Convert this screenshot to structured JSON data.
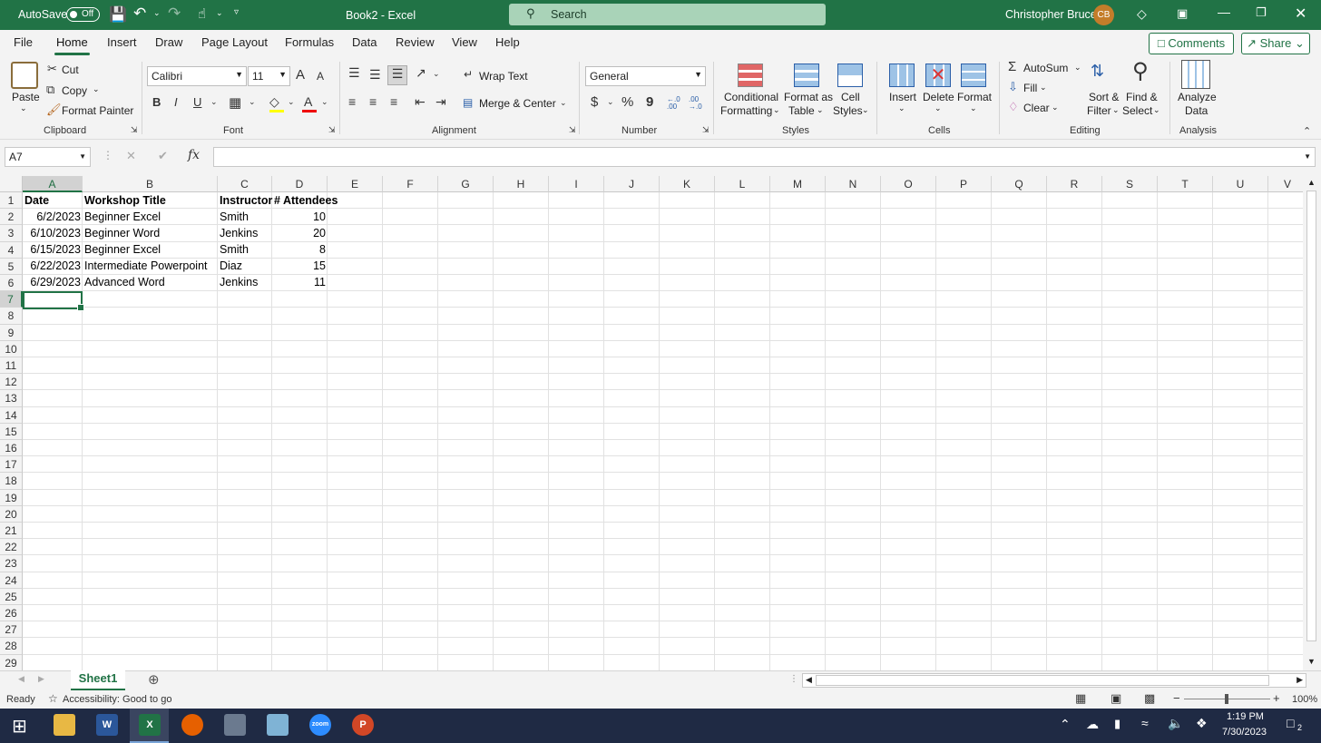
{
  "titlebar": {
    "autosave_label": "AutoSave",
    "autosave_state": "Off",
    "doc_title": "Book2  -  Excel",
    "search_placeholder": "Search",
    "user_name": "Christopher Bruce",
    "user_initials": "CB"
  },
  "tabs": [
    "File",
    "Home",
    "Insert",
    "Draw",
    "Page Layout",
    "Formulas",
    "Data",
    "Review",
    "View",
    "Help"
  ],
  "active_tab": "Home",
  "tab_buttons": {
    "comments": "Comments",
    "share": "Share"
  },
  "ribbon": {
    "clipboard": {
      "paste": "Paste",
      "cut": "Cut",
      "copy": "Copy",
      "format_painter": "Format Painter",
      "group": "Clipboard"
    },
    "font": {
      "name": "Calibri",
      "size": "11",
      "grow": "A",
      "shrink": "A",
      "bold": "B",
      "italic": "I",
      "underline": "U",
      "font_color": "A",
      "group": "Font"
    },
    "alignment": {
      "wrap": "Wrap Text",
      "merge": "Merge & Center",
      "group": "Alignment"
    },
    "number": {
      "format": "General",
      "currency": "$",
      "percent": "%",
      "comma": "9",
      "inc": "←.0 .00",
      "dec": ".00 →.0",
      "group": "Number"
    },
    "styles": {
      "conditional": "Conditional",
      "conditional2": "Formatting",
      "format_table": "Format as",
      "format_table2": "Table",
      "cell_styles": "Cell",
      "cell_styles2": "Styles",
      "group": "Styles"
    },
    "cells": {
      "insert": "Insert",
      "delete": "Delete",
      "format": "Format",
      "group": "Cells"
    },
    "editing": {
      "autosum": "AutoSum",
      "fill": "Fill",
      "clear": "Clear",
      "sort": "Sort &",
      "sort2": "Filter",
      "find": "Find &",
      "find2": "Select",
      "group": "Editing"
    },
    "analysis": {
      "analyze": "Analyze",
      "analyze2": "Data",
      "group": "Analysis"
    }
  },
  "formula_bar": {
    "name_box": "A7",
    "cancel": "✕",
    "enter": "✔",
    "fx": "fx",
    "value": ""
  },
  "columns": [
    "A",
    "B",
    "C",
    "D",
    "E",
    "F",
    "G",
    "H",
    "I",
    "J",
    "K",
    "L",
    "M",
    "N",
    "O",
    "P",
    "Q",
    "R",
    "S",
    "T",
    "U",
    "V"
  ],
  "rows": [
    "1",
    "2",
    "3",
    "4",
    "5",
    "6",
    "7",
    "8",
    "9",
    "10",
    "11",
    "12",
    "13",
    "14",
    "15",
    "16",
    "17",
    "18",
    "19",
    "20",
    "21",
    "22",
    "23",
    "24",
    "25",
    "26",
    "27",
    "28",
    "29"
  ],
  "headers": [
    "Date",
    "Workshop Title",
    "Instructor",
    "# Attendees"
  ],
  "table_rows": [
    [
      "6/2/2023",
      "Beginner Excel",
      "Smith",
      "10"
    ],
    [
      "6/10/2023",
      "Beginner Word",
      "Jenkins",
      "20"
    ],
    [
      "6/15/2023",
      "Beginner Excel",
      "Smith",
      "8"
    ],
    [
      "6/22/2023",
      "Intermediate Powerpoint",
      "Diaz",
      "15"
    ],
    [
      "6/29/2023",
      "Advanced Word",
      "Jenkins",
      "11"
    ]
  ],
  "selected_cell": "A7",
  "sheet_tab": "Sheet1",
  "status": {
    "ready": "Ready",
    "accessibility": "Accessibility: Good to go",
    "zoom": "100%"
  },
  "taskbar": {
    "time": "1:19 PM",
    "date": "7/30/2023",
    "notifications": "2"
  },
  "colors": {
    "excel_green": "#217346",
    "taskbar": "#1f2a44"
  }
}
